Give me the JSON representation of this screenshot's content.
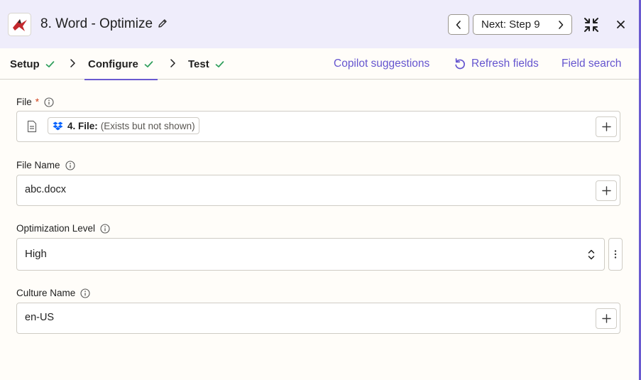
{
  "header": {
    "title": "8. Word - Optimize",
    "next_label": "Next: Step 9",
    "icons": {
      "logo": "app-logo-icon",
      "edit": "pencil-icon",
      "prev": "chevron-left-icon",
      "next": "chevron-right-icon",
      "collapse": "collapse-icon",
      "close": "close-icon"
    }
  },
  "tabs": [
    {
      "label": "Setup",
      "complete": true
    },
    {
      "label": "Configure",
      "complete": true,
      "active": true
    },
    {
      "label": "Test",
      "complete": true
    }
  ],
  "toolbar": {
    "copilot": "Copilot suggestions",
    "refresh": "Refresh fields",
    "search": "Field search"
  },
  "fields": {
    "file": {
      "label": "File",
      "required_mark": "*",
      "pill_step": "4. File:",
      "pill_note": "(Exists but not shown)"
    },
    "file_name": {
      "label": "File Name",
      "value": "abc.docx"
    },
    "optimization_level": {
      "label": "Optimization Level",
      "value": "High"
    },
    "culture_name": {
      "label": "Culture Name",
      "value": "en-US"
    }
  },
  "colors": {
    "accent": "#6a5ad0",
    "link": "#6555cf",
    "check": "#2e9e5b",
    "required": "#d0421b",
    "header_bg": "#efedfb",
    "logo_red": "#c3282e"
  }
}
